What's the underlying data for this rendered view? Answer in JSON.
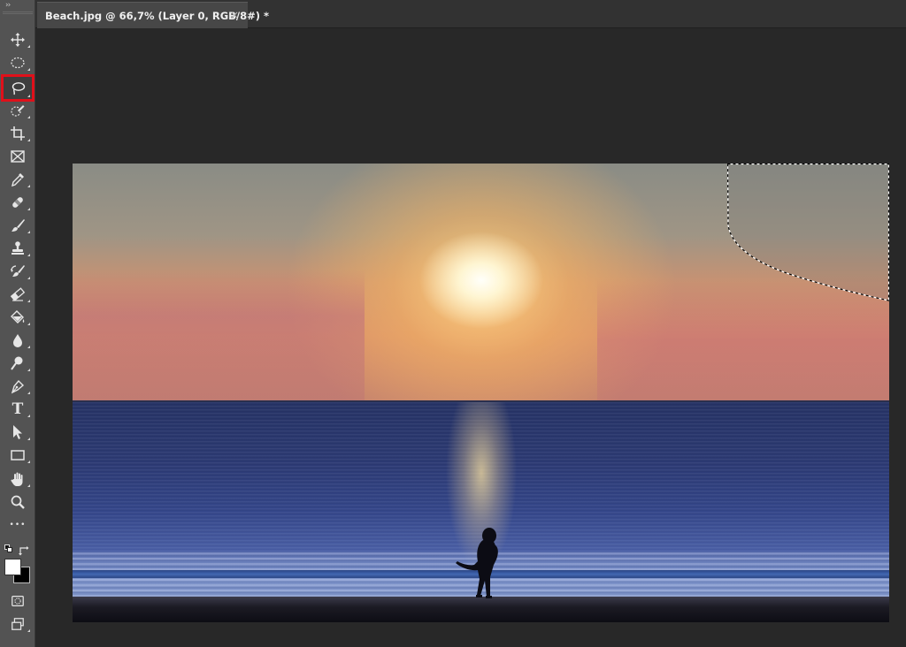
{
  "document": {
    "tab_title": "Beach.jpg @ 66,7% (Layer 0, RGB/8#) *",
    "close_glyph": "×"
  },
  "toolbar": {
    "collapse_glyph": "››",
    "active_tool": "lasso-tool",
    "tools": [
      {
        "name": "move-tool",
        "icon": "move-icon"
      },
      {
        "name": "marquee-tool",
        "icon": "elliptical-marquee-icon"
      },
      {
        "name": "lasso-tool",
        "icon": "lasso-icon"
      },
      {
        "name": "quick-selection-tool",
        "icon": "quick-selection-icon"
      },
      {
        "name": "crop-tool",
        "icon": "crop-icon"
      },
      {
        "name": "frame-tool",
        "icon": "frame-icon"
      },
      {
        "name": "eyedropper-tool",
        "icon": "eyedropper-icon"
      },
      {
        "name": "healing-brush-tool",
        "icon": "bandage-icon"
      },
      {
        "name": "brush-tool",
        "icon": "brush-icon"
      },
      {
        "name": "clone-stamp-tool",
        "icon": "stamp-icon"
      },
      {
        "name": "history-brush-tool",
        "icon": "history-brush-icon"
      },
      {
        "name": "eraser-tool",
        "icon": "eraser-icon"
      },
      {
        "name": "paint-bucket-tool",
        "icon": "paint-bucket-icon"
      },
      {
        "name": "blur-tool",
        "icon": "drop-icon"
      },
      {
        "name": "dodge-tool",
        "icon": "dodge-icon"
      },
      {
        "name": "pen-tool",
        "icon": "pen-icon"
      },
      {
        "name": "type-tool",
        "icon": "type-icon",
        "glyph": "T"
      },
      {
        "name": "path-selection-tool",
        "icon": "arrow-icon"
      },
      {
        "name": "rectangle-tool",
        "icon": "rectangle-icon"
      },
      {
        "name": "hand-tool",
        "icon": "hand-icon"
      },
      {
        "name": "zoom-tool",
        "icon": "zoom-icon"
      },
      {
        "name": "more-tools",
        "icon": "ellipsis-icon",
        "glyph": "•••"
      }
    ],
    "foreground_color": "#ffffff",
    "background_color": "#000000"
  },
  "colors": {
    "toolbar_bg": "#535353",
    "workspace_bg": "#282828",
    "highlight": "#e0101a"
  }
}
